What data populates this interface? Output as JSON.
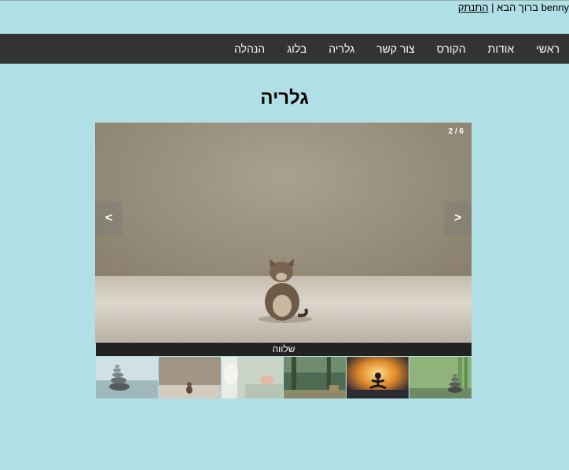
{
  "user": {
    "name": "benny",
    "welcome": "ברוך הבא",
    "separator": "|",
    "logout": "התנתק"
  },
  "nav": {
    "items": [
      {
        "label": "ראשי"
      },
      {
        "label": "אודות"
      },
      {
        "label": "הקורס"
      },
      {
        "label": "צור קשר"
      },
      {
        "label": "גלריה"
      },
      {
        "label": "בלוג"
      },
      {
        "label": "הנהלה"
      }
    ]
  },
  "page": {
    "title": "גלריה"
  },
  "slider": {
    "counter": "2 / 6",
    "prev": "<",
    "next": ">",
    "caption": "שלווה"
  },
  "colors": {
    "background": "#b0dfe5",
    "nav": "#333333",
    "caption": "#222222"
  }
}
